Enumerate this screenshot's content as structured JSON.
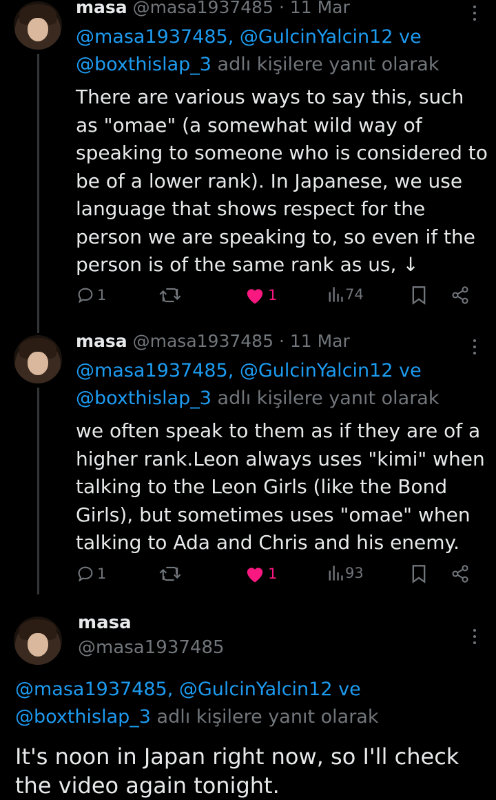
{
  "tweets": [
    {
      "name": "masa",
      "handle": "@masa1937485",
      "separator": "·",
      "date": "11 Mar",
      "reply_to_links": "@masa1937485, @GulcinYalcin12 ve",
      "reply_to_link2": "@boxthislap_3",
      "reply_to_suffix": "adlı kişilere yanıt olarak",
      "text": "There are various ways to say this, such as \"omae\" (a somewhat wild way of speaking to someone who is considered to be of a lower rank). In Japanese, we use language that shows respect for the person we are speaking to, so even if the person is of the same rank as us, ↓",
      "replies": "1",
      "likes": "1",
      "views": "74"
    },
    {
      "name": "masa",
      "handle": "@masa1937485",
      "separator": "·",
      "date": "11 Mar",
      "reply_to_links": "@masa1937485, @GulcinYalcin12 ve",
      "reply_to_link2": "@boxthislap_3",
      "reply_to_suffix": "adlı kişilere yanıt olarak",
      "text": "we often speak to them as if they are of a higher rank.Leon always uses \"kimi\" when talking to the Leon Girls (like the Bond Girls), but sometimes uses \"omae\" when talking to Ada and Chris and his enemy.",
      "replies": "1",
      "likes": "1",
      "views": "93"
    }
  ],
  "focused": {
    "name": "masa",
    "handle": "@masa1937485",
    "reply_to_links": "@masa1937485, @GulcinYalcin12 ve",
    "reply_to_link2": "@boxthislap_3",
    "reply_to_suffix": "adlı kişilere yanıt olarak",
    "text": "It's noon in Japan right now, so I'll check the video again tonight."
  },
  "colors": {
    "background": "#000000",
    "link": "#1d9bf0",
    "muted": "#71767b",
    "like": "#f91880",
    "text": "#e7e9ea"
  }
}
